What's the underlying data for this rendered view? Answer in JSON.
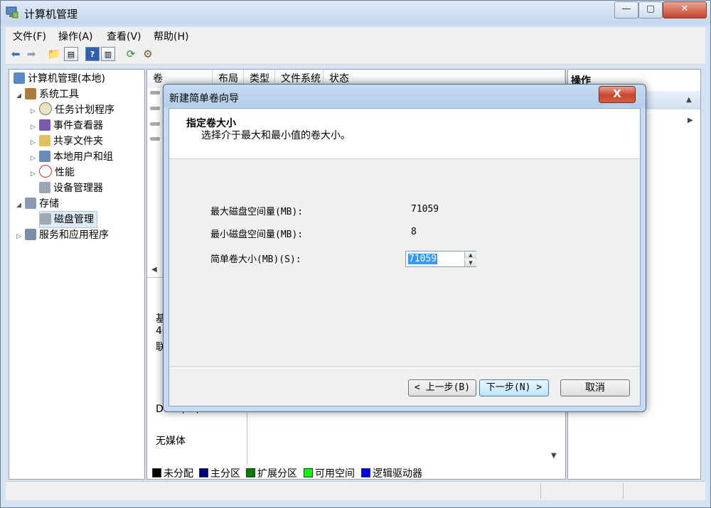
{
  "window": {
    "title": "计算机管理",
    "minimize": "—",
    "maximize": "▢",
    "close": "✕"
  },
  "menu": [
    "文件(F)",
    "操作(A)",
    "查看(V)",
    "帮助(H)"
  ],
  "tree": {
    "items": [
      {
        "label": "计算机管理(本地)",
        "level": 0,
        "arrow": ""
      },
      {
        "label": "系统工具",
        "level": 1,
        "arrow": "◢"
      },
      {
        "label": "任务计划程序",
        "level": 2,
        "arrow": "▷"
      },
      {
        "label": "事件查看器",
        "level": 2,
        "arrow": "▷"
      },
      {
        "label": "共享文件夹",
        "level": 2,
        "arrow": "▷"
      },
      {
        "label": "本地用户和组",
        "level": 2,
        "arrow": "▷"
      },
      {
        "label": "性能",
        "level": 2,
        "arrow": "▷"
      },
      {
        "label": "设备管理器",
        "level": 2,
        "arrow": ""
      },
      {
        "label": "存储",
        "level": 1,
        "arrow": "◢"
      },
      {
        "label": "磁盘管理",
        "level": 2,
        "arrow": "",
        "selected": true
      },
      {
        "label": "服务和应用程序",
        "level": 1,
        "arrow": "▷"
      }
    ]
  },
  "columns": [
    "卷",
    "布局",
    "类型",
    "文件系统",
    "状态"
  ],
  "disk_panel": {
    "disk0_line1": "基",
    "disk0_line2": "40",
    "disk0_line3": "联",
    "dvd_label": "DVD (G:)",
    "dvd_media": "无媒体"
  },
  "legend": [
    {
      "label": "未分配",
      "color": "#000000"
    },
    {
      "label": "主分区",
      "color": "#00007f"
    },
    {
      "label": "扩展分区",
      "color": "#007f00"
    },
    {
      "label": "可用空间",
      "color": "#00ff00"
    },
    {
      "label": "逻辑驱动器",
      "color": "#0000ff"
    }
  ],
  "actions": {
    "header": "操作"
  },
  "wizard": {
    "title": "新建简单卷向导",
    "close": "X",
    "heading": "指定卷大小",
    "subheading": "选择介于最大和最小值的卷大小。",
    "max_label": "最大磁盘空间量(MB):",
    "max_value": "71059",
    "min_label": "最小磁盘空间量(MB):",
    "min_value": "8",
    "size_label": "简单卷大小(MB)(S):",
    "size_value": "71059",
    "back_button": "< 上一步(B)",
    "next_button": "下一步(N) >",
    "cancel_button": "取消"
  }
}
